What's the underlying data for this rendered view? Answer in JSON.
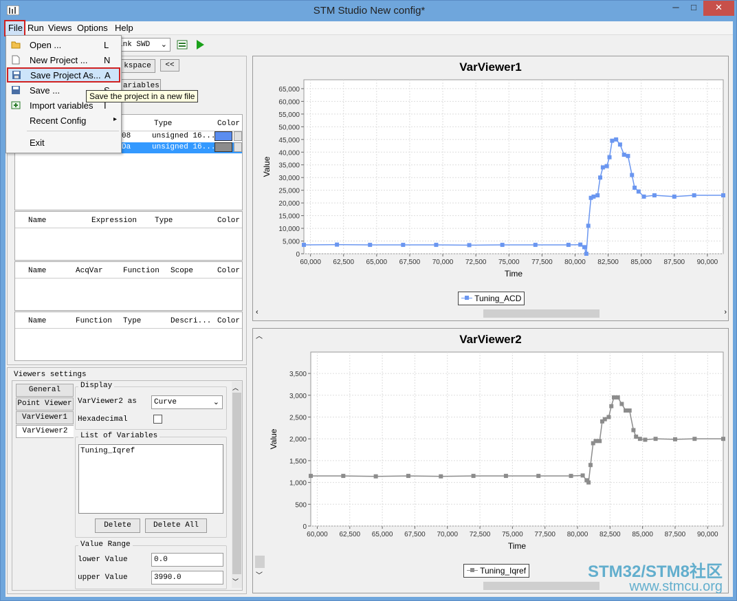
{
  "window": {
    "title": "STM Studio New config*",
    "minimize": "─",
    "maximize": "□",
    "close": "✕"
  },
  "menubar": {
    "items": [
      "File",
      "Run",
      "Views",
      "Options",
      "Help"
    ]
  },
  "toolbar": {
    "probe_value": "ink SWD"
  },
  "file_menu": {
    "items": [
      {
        "label": "Open ...",
        "key": "L",
        "icon": "folder-open-icon"
      },
      {
        "label": "New Project ...",
        "key": "N",
        "icon": "new-file-icon"
      },
      {
        "label": "Save Project As...",
        "key": "A",
        "icon": "save-as-icon"
      },
      {
        "label": "Save ...",
        "key": "S",
        "icon": "save-icon"
      },
      {
        "label": "Import variables",
        "key": "I",
        "icon": "import-icon"
      },
      {
        "label": "Recent Config",
        "key": "▸",
        "icon": ""
      },
      {
        "label": "Exit",
        "key": "",
        "icon": ""
      }
    ],
    "tooltip": "Save the project in a new file"
  },
  "left_panel": {
    "workspace_button": "kspace",
    "collapse_button": "<<",
    "variables_button": "ariables",
    "variables_table": {
      "col_type": "Type",
      "col_color": "Color",
      "rows": [
        {
          "name": "08",
          "type": "unsigned 16...",
          "color": "#5b8def"
        },
        {
          "name": "Da",
          "type": "unsigned 16...",
          "color": "#8c8c8c"
        }
      ]
    },
    "expressions_table": {
      "columns": [
        "Name",
        "Expression",
        "Type",
        "Color"
      ]
    },
    "acq_table": {
      "columns": [
        "Name",
        "AcqVar",
        "Function",
        "Scope",
        "Color"
      ]
    },
    "func_table": {
      "columns": [
        "Name",
        "Function",
        "Type",
        "Descri...",
        "Color"
      ]
    }
  },
  "viewers_settings": {
    "title": "Viewers settings",
    "tabs": [
      "General",
      "Point Viewer",
      "VarViewer1",
      "VarViewer2"
    ],
    "display": {
      "group_label": "Display",
      "as_label": "VarViewer2 as",
      "as_value": "Curve",
      "hex_label": "Hexadecimal"
    },
    "list_of_variables": {
      "group_label": "List of Variables",
      "items": [
        "Tuning_Iqref"
      ]
    },
    "delete_button": "Delete",
    "delete_all_button": "Delete All",
    "value_range": {
      "group_label": "Value Range",
      "lower_label": "lower Value",
      "lower_value": "0.0",
      "upper_label": "upper Value",
      "upper_value": "3990.0"
    }
  },
  "chart_data": [
    {
      "type": "line",
      "title": "VarViewer1",
      "xlabel": "Time",
      "ylabel": "Value",
      "xlim": [
        59500,
        91200
      ],
      "ylim": [
        0,
        68500
      ],
      "xticks": [
        "60,000",
        "62,500",
        "65,000",
        "67,500",
        "70,000",
        "72,500",
        "75,000",
        "77,500",
        "80,000",
        "82,500",
        "85,000",
        "87,500",
        "90,000"
      ],
      "yticks": [
        "0",
        "5,000",
        "10,000",
        "15,000",
        "20,000",
        "25,000",
        "30,000",
        "35,000",
        "40,000",
        "45,000",
        "50,000",
        "55,000",
        "60,000",
        "65,000"
      ],
      "grid": true,
      "legend_position": "bottom-center",
      "series": [
        {
          "name": "Tuning_ACD",
          "color": "#6a96f0",
          "x": [
            59500,
            62000,
            64500,
            67000,
            69500,
            72000,
            74500,
            77000,
            79500,
            80400,
            80700,
            80850,
            81000,
            81200,
            81400,
            81700,
            81900,
            82100,
            82400,
            82600,
            82800,
            83100,
            83400,
            83700,
            84000,
            84300,
            84500,
            84800,
            85200,
            86000,
            87500,
            89000,
            91200
          ],
          "values": [
            3500,
            3600,
            3500,
            3500,
            3500,
            3400,
            3500,
            3500,
            3500,
            3600,
            2600,
            0,
            11000,
            22000,
            22500,
            23000,
            30000,
            34000,
            34500,
            38000,
            44500,
            45000,
            43000,
            39000,
            38500,
            31000,
            26000,
            24500,
            22500,
            23000,
            22500,
            23000,
            23000
          ]
        }
      ]
    },
    {
      "type": "line",
      "title": "VarViewer2",
      "xlabel": "Time",
      "ylabel": "Value",
      "xlim": [
        59500,
        91200
      ],
      "ylim": [
        0,
        3990
      ],
      "xticks": [
        "60,000",
        "62,500",
        "65,000",
        "67,500",
        "70,000",
        "72,500",
        "75,000",
        "77,500",
        "80,000",
        "82,500",
        "85,000",
        "87,500",
        "90,000"
      ],
      "yticks": [
        "0",
        "500",
        "1,000",
        "1,500",
        "2,000",
        "2,500",
        "3,000",
        "3,500"
      ],
      "grid": true,
      "legend_position": "bottom-center",
      "series": [
        {
          "name": "Tuning_Iqref",
          "color": "#8c8c8c",
          "x": [
            59500,
            62000,
            64500,
            67000,
            69500,
            72000,
            74500,
            77000,
            79500,
            80400,
            80700,
            80850,
            81000,
            81200,
            81400,
            81700,
            81900,
            82100,
            82400,
            82600,
            82800,
            83100,
            83400,
            83700,
            84000,
            84300,
            84500,
            84800,
            85200,
            86000,
            87500,
            89000,
            91200
          ],
          "values": [
            1150,
            1150,
            1140,
            1150,
            1140,
            1150,
            1150,
            1150,
            1150,
            1160,
            1050,
            1000,
            1400,
            1900,
            1950,
            1950,
            2400,
            2450,
            2500,
            2750,
            2950,
            2950,
            2800,
            2650,
            2650,
            2200,
            2050,
            2000,
            1980,
            2000,
            1990,
            2000,
            2000
          ]
        }
      ]
    }
  ],
  "watermark": {
    "line1": "STM32/STM8社区",
    "line2": "www.stmcu.org"
  }
}
